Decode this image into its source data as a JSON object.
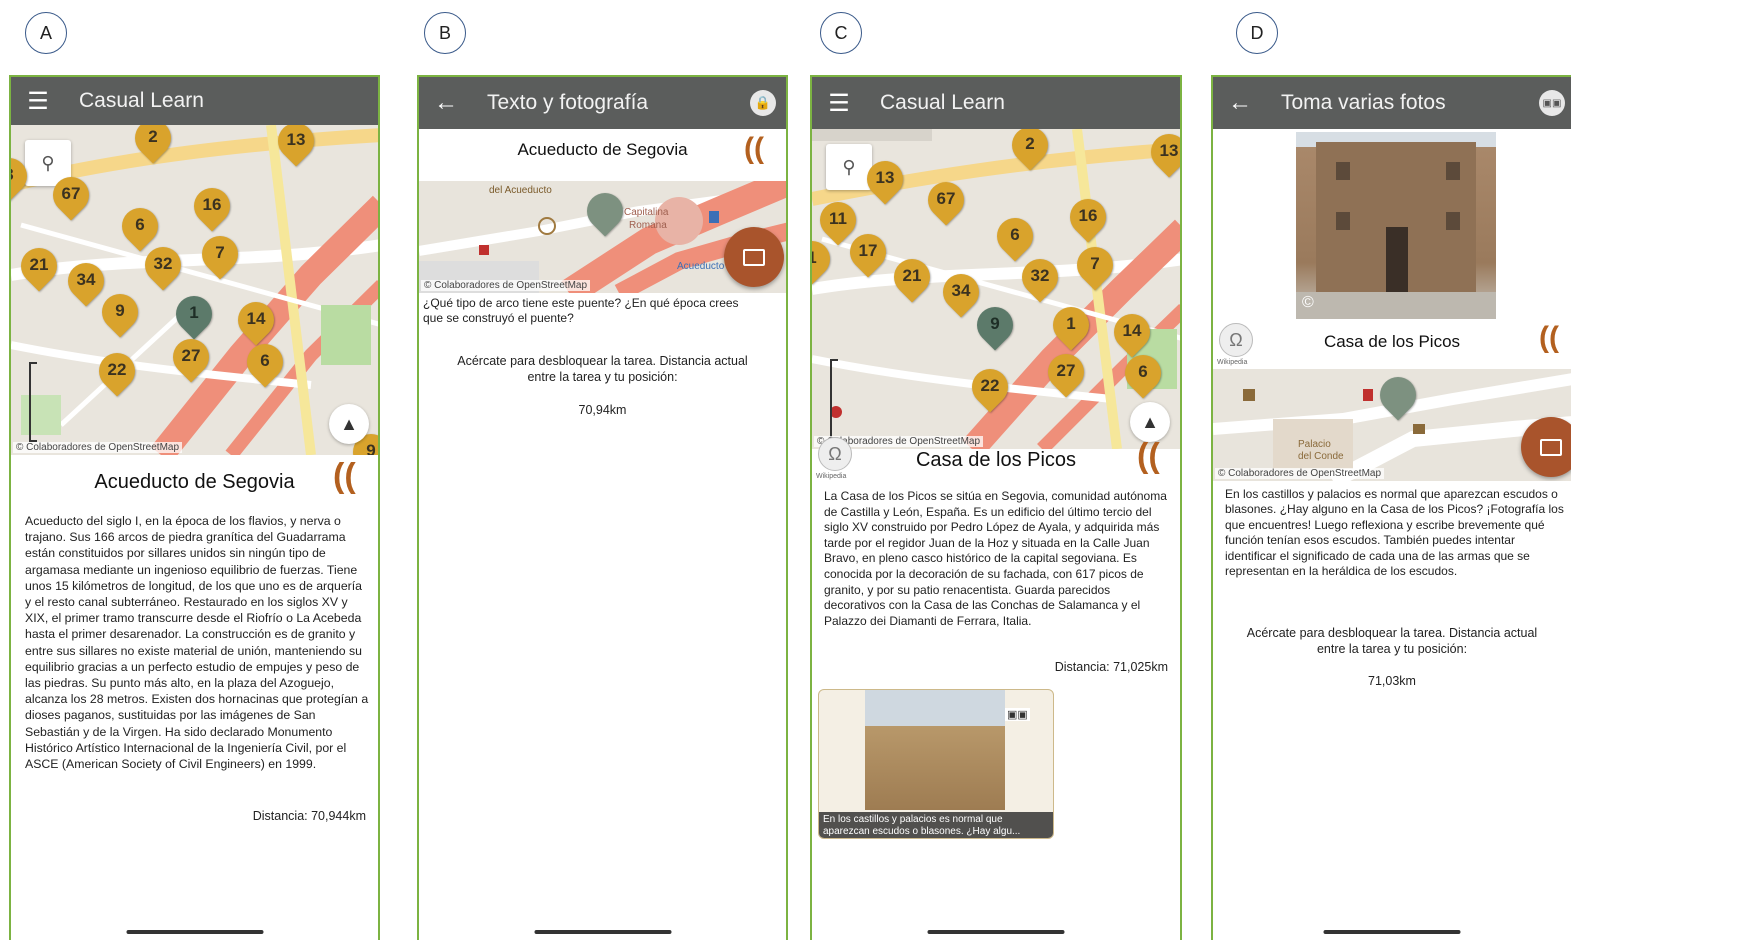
{
  "panels": {
    "a": {
      "letter": "A",
      "appbar_title": "Casual Learn",
      "menu_icon": "☰",
      "search_icon": "⚲",
      "compass_icon": "▲",
      "attribution": "© Colaboradores de OpenStreetMap",
      "pins": [
        "2",
        "13",
        "67",
        "16",
        "6",
        "7",
        "21",
        "34",
        "32",
        "9",
        "1",
        "14",
        "22",
        "27",
        "6",
        "9",
        "3"
      ],
      "place_title": "Acueducto de Segovia",
      "description": "Acueducto del siglo I, en la época de los flavios, y nerva o trajano. Sus 166 arcos de piedra granítica del Guadarrama están constituidos por sillares unidos sin ningún tipo de argamasa mediante un ingenioso equilibrio de fuerzas. Tiene unos 15 kilómetros de longitud, de los que uno es de arquería y el resto canal subterráneo. Restaurado en los siglos XV y XIX, el primer tramo transcurre desde el Riofrío o La Acebeda hasta el primer desarenador. La construcción es de granito y entre sus sillares no existe material de unión, manteniendo su equilibrio gracias a un perfecto estudio de empujes y peso de las piedras. Su punto más alto, en la plaza del Azoguejo, alcanza los 28 metros. Existen dos hornacinas que protegían a dioses paganos, sustituidas por las imágenes de San Sebastián y de la Virgen. Ha sido declarado Monumento Histórico Artístico Internacional de la Ingeniería Civil, por el ASCE (American Society of Civil Engineers) en 1999.",
      "distance": "Distancia: 70,944km"
    },
    "b": {
      "letter": "B",
      "appbar_title": "Texto y fotografía",
      "back_icon": "←",
      "lock_icon": "🔒",
      "place_title": "Acueducto de Segovia",
      "attribution": "© Colaboradores de OpenStreetMap",
      "map_labels": [
        "del Acueducto",
        "Capitalina",
        "Romana",
        "Acueducto"
      ],
      "question": "¿Qué tipo de arco tiene este puente? ¿En qué época crees que se construyó el puente?",
      "unlock_msg": "Acércate para desbloquear la tarea. Distancia actual entre la tarea y tu posición:",
      "distance": "70,94km"
    },
    "c": {
      "letter": "C",
      "appbar_title": "Casual Learn",
      "menu_icon": "☰",
      "search_icon": "⚲",
      "compass_icon": "▲",
      "attribution": "© Colaboradores de OpenStreetMap",
      "pins": [
        "2",
        "13",
        "13",
        "67",
        "16",
        "11",
        "6",
        "1",
        "17",
        "21",
        "34",
        "32",
        "7",
        "9",
        "1",
        "14",
        "27",
        "22",
        "6"
      ],
      "wiki_label": "Wikipedia",
      "place_title": "Casa de los Picos",
      "description": "La Casa de los Picos se sitúa en Segovia, comunidad autónoma de Castilla y León, España. Es un edificio del último tercio del siglo XV construido por Pedro López de Ayala, y adquirida más tarde por el regidor Juan de la Hoz y situada en la Calle Juan Bravo, en pleno casco histórico de la capital segoviana. Es conocida por la decoración de su fachada, con 617 picos de granito, y por su patio renacentista. Guarda parecidos decorativos con la Casa de las Conchas de Salamanca y el Palazzo dei Diamanti de Ferrara, Italia.",
      "distance": "Distancia: 71,025km",
      "card_caption": "En los castillos y palacios es normal que aparezcan escudos o blasones. ¿Hay algu..."
    },
    "d": {
      "letter": "D",
      "appbar_title": "Toma varias fotos",
      "back_icon": "←",
      "multi_photo_icon": "▣▣",
      "copyright_icon": "©",
      "wiki_label": "Wikipedia",
      "place_title": "Casa de los Picos",
      "attribution": "© Colaboradores de OpenStreetMap",
      "map_labels": [
        "Palacio",
        "del Conde"
      ],
      "question": "En los castillos y palacios es normal que aparezcan escudos o blasones. ¿Hay alguno en la Casa de los Picos? ¡Fotografía los que encuentres! Luego reflexiona y escribe brevemente qué función tenían esos escudos. También puedes intentar identificar el significado de cada una de las armas que se representan en la heráldica de los escudos.",
      "unlock_msg": "Acércate para desbloquear la tarea. Distancia actual entre la tarea y tu posición:",
      "distance": "71,03km"
    }
  },
  "colors": {
    "appbar": "#5b5d5c",
    "pin": "#d9a32c",
    "pin_selected": "#5c7a6a",
    "fab": "#a9542c",
    "frame": "#7cb342"
  }
}
